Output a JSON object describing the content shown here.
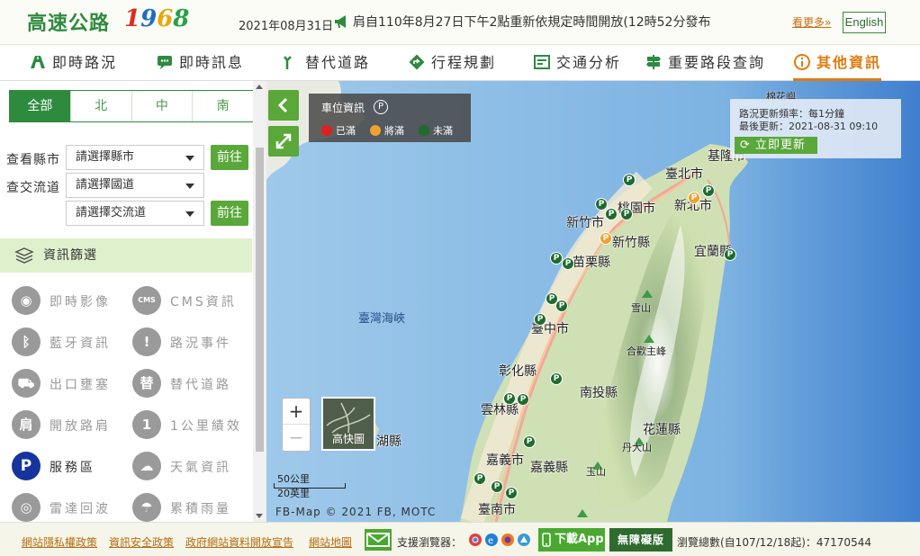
{
  "header": {
    "logo_text": "高速公路",
    "logo_num_1": "1",
    "logo_num_9": "9",
    "logo_num_6": "6",
    "logo_num_8": "8",
    "date": "2021年08月31日",
    "marquee": "肩自110年8月27日下午2點重新依規定時間開放(12時52分發布",
    "more_label": "看更多»",
    "english_label": "English"
  },
  "nav": {
    "items": [
      {
        "label": "即時路況",
        "icon": "highway-icon"
      },
      {
        "label": "即時訊息",
        "icon": "message-icon"
      },
      {
        "label": "替代道路",
        "icon": "route-icon"
      },
      {
        "label": "行程規劃",
        "icon": "direction-icon"
      },
      {
        "label": "交通分析",
        "icon": "chart-icon"
      },
      {
        "label": "重要路段查詢",
        "icon": "signpost-icon"
      },
      {
        "label": "其他資訊",
        "icon": "info-icon",
        "active": true
      }
    ]
  },
  "sidebar": {
    "regions": [
      "全部",
      "北",
      "中",
      "南"
    ],
    "active_region": "全部",
    "county_label": "查看縣市",
    "county_select": "請選擇縣市",
    "interchange_label": "查交流道",
    "freeway_select": "請選擇國道",
    "interchange_select": "請選擇交流道",
    "go_label": "前往",
    "filter_title": "資訊篩選",
    "filters": [
      {
        "label": "即時影像",
        "icon": "camera-icon",
        "glyph": "◉"
      },
      {
        "label": "CMS資訊",
        "icon": "cms-icon",
        "glyph": "CMS"
      },
      {
        "label": "藍牙資訊",
        "icon": "bluetooth-icon",
        "glyph": "ᛒ"
      },
      {
        "label": "路況事件",
        "icon": "warning-icon",
        "glyph": "!"
      },
      {
        "label": "出口壅塞",
        "icon": "congestion-icon",
        "glyph": "⛟"
      },
      {
        "label": "替代道路",
        "icon": "alt-road-icon",
        "glyph": "替"
      },
      {
        "label": "開放路肩",
        "icon": "shoulder-icon",
        "glyph": "肩"
      },
      {
        "label": "1公里績效",
        "icon": "km-icon",
        "glyph": "1"
      },
      {
        "label": "服務區",
        "icon": "parking-icon",
        "glyph": "P",
        "active": true
      },
      {
        "label": "天氣資訊",
        "icon": "weather-icon",
        "glyph": "☁"
      },
      {
        "label": "雷達回波",
        "icon": "radar-icon",
        "glyph": "◎"
      },
      {
        "label": "累積雨量",
        "icon": "rain-icon",
        "glyph": "☂"
      }
    ]
  },
  "map": {
    "legend_title": "車位資訊",
    "legend_p": "P",
    "legend_items": [
      {
        "label": "已滿",
        "color": "#e02020"
      },
      {
        "label": "將滿",
        "color": "#f0a030"
      },
      {
        "label": "未滿",
        "color": "#1f6b2e"
      }
    ],
    "update_freq": "路況更新頻率：每1分鐘",
    "update_last": "最後更新：2021-08-31 09:10",
    "update_button": "立即更新",
    "thumb_label": "高快圖",
    "scale_km": "50公里",
    "scale_mi": "20英里",
    "attribution": "FB-Map © 2021 FB, MOTC",
    "labels": {
      "mianhua": "棉花嶼",
      "keelung": "基隆市",
      "taipei": "臺北市",
      "newtaipei": "新北市",
      "taoyuan": "桃園市",
      "hsinchu_city": "新竹市",
      "hsinchu_county": "新竹縣",
      "yilan": "宜蘭縣",
      "miaoli": "苗栗縣",
      "strait": "臺灣海峽",
      "taichung": "臺中市",
      "changhua": "彰化縣",
      "nantou": "南投縣",
      "yunlin": "雲林縣",
      "hualien": "花蓮縣",
      "chiayi_city": "嘉義市",
      "chiayi_county": "嘉義縣",
      "tainan": "臺南市",
      "penghu": "湖縣",
      "xueshan": "雪山",
      "hehuan": "合歡主峰",
      "danda": "丹大山",
      "yushan": "玉山"
    }
  },
  "footer": {
    "links": [
      "網站隱私權政策",
      "資訊安全政策",
      "政府網站資料開放宣告",
      "網站地圖"
    ],
    "browser_label": "支援瀏覽器：",
    "app_label": "下載App",
    "accessible_label": "無障礙版",
    "visits": "瀏覽總數(自107/12/18起)：47170544"
  }
}
